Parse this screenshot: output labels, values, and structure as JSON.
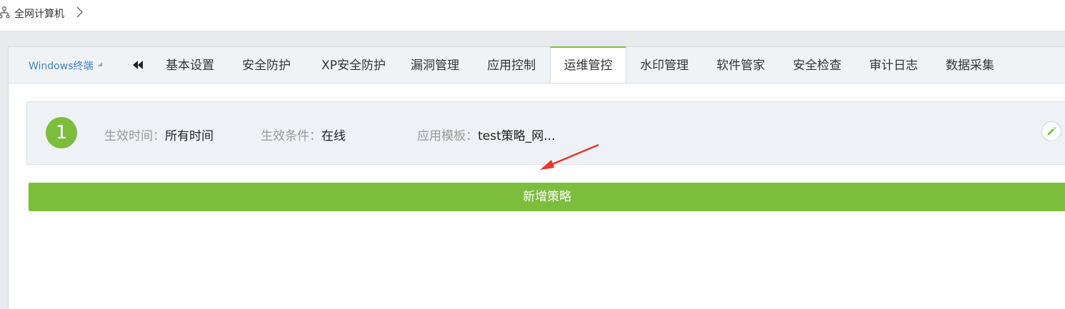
{
  "breadcrumb": {
    "label": "全网计算机",
    "icon": "network-icon",
    "chevron": "chevron-right-icon"
  },
  "os_select": {
    "value": "Windows终端"
  },
  "tabs": [
    {
      "label": "基本设置"
    },
    {
      "label": "安全防护"
    },
    {
      "label": "XP安全防护"
    },
    {
      "label": "漏洞管理"
    },
    {
      "label": "应用控制"
    },
    {
      "label": "运维管控",
      "active": true
    },
    {
      "label": "水印管理"
    },
    {
      "label": "软件管家"
    },
    {
      "label": "安全检查"
    },
    {
      "label": "审计日志"
    },
    {
      "label": "数据采集"
    }
  ],
  "policy": {
    "number": "1",
    "effective_time_label": "生效时间：",
    "effective_time_value": "所有时间",
    "condition_label": "生效条件：",
    "condition_value": "在线",
    "template_label": "应用模板：",
    "template_value": "test策略_网..."
  },
  "add_button": {
    "label": "新增策略"
  },
  "colors": {
    "accent_green": "#7cbd3c",
    "link_blue": "#3a86c8",
    "annotation_red": "#e8352e"
  }
}
